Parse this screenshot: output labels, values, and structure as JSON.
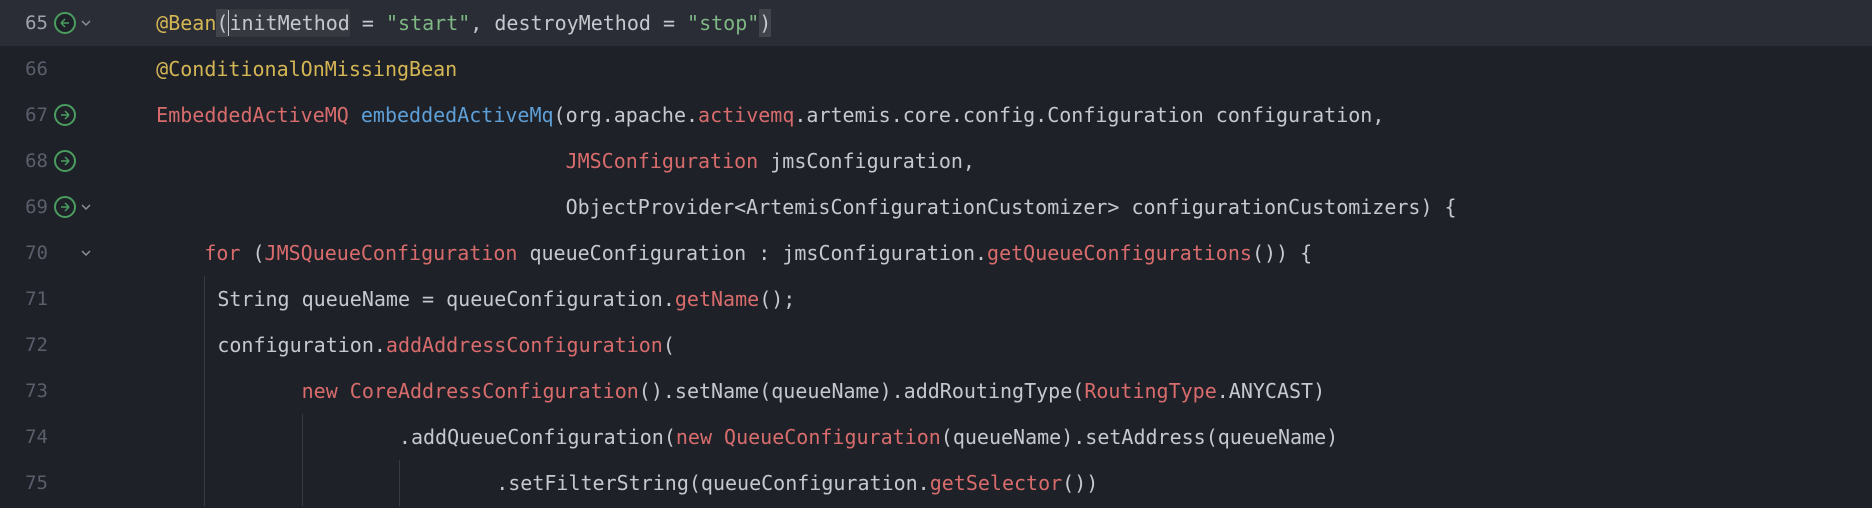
{
  "lines": {
    "l65": {
      "num": "65",
      "annotation": "@Bean",
      "paren_open": "(",
      "param1_name": "initMethod",
      "eq1": " = ",
      "param1_value": "\"start\"",
      "sep": ", ",
      "param2_name": "destroyMethod",
      "eq2": " = ",
      "param2_value": "\"stop\"",
      "paren_close": ")"
    },
    "l66": {
      "num": "66",
      "annotation": "@ConditionalOnMissingBean"
    },
    "l67": {
      "num": "67",
      "type": "EmbeddedActiveMQ",
      "sp1": " ",
      "method": "embeddedActiveMq",
      "paren": "(",
      "pkg1": "org.apache.",
      "pkg_hl": "activemq",
      "pkg2": ".artemis.core.config.Configuration configuration,"
    },
    "l68": {
      "num": "68",
      "type": "JMSConfiguration",
      "rest": " jmsConfiguration,"
    },
    "l69": {
      "num": "69",
      "text1": "ObjectProvider<ArtemisConfigurationCustomizer> configurationCustomizers) {"
    },
    "l70": {
      "num": "70",
      "kw_for": "for",
      "p1": " (",
      "type": "JMSQueueConfiguration",
      "mid": " queueConfiguration : jmsConfiguration.",
      "call": "getQueueConfigurations",
      "p2": "()) {"
    },
    "l71": {
      "num": "71",
      "text1": "String queueName = queueConfiguration.",
      "call": "getName",
      "p": "();"
    },
    "l72": {
      "num": "72",
      "text1": "configuration.",
      "call": "addAddressConfiguration",
      "p": "("
    },
    "l73": {
      "num": "73",
      "kw_new": "new",
      "sp": " ",
      "type": "CoreAddressConfiguration",
      "mid": "().setName(queueName).addRoutingType(",
      "type2": "RoutingType",
      "rest": ".ANYCAST)"
    },
    "l74": {
      "num": "74",
      "text1": ".addQueueConfiguration(",
      "kw_new": "new",
      "sp": " ",
      "type": "QueueConfiguration",
      "rest": "(queueName).setAddress(queueName)"
    },
    "l75": {
      "num": "75",
      "text1": ".setFilterString(queueConfiguration.",
      "call": "getSelector",
      "p": "())"
    }
  }
}
